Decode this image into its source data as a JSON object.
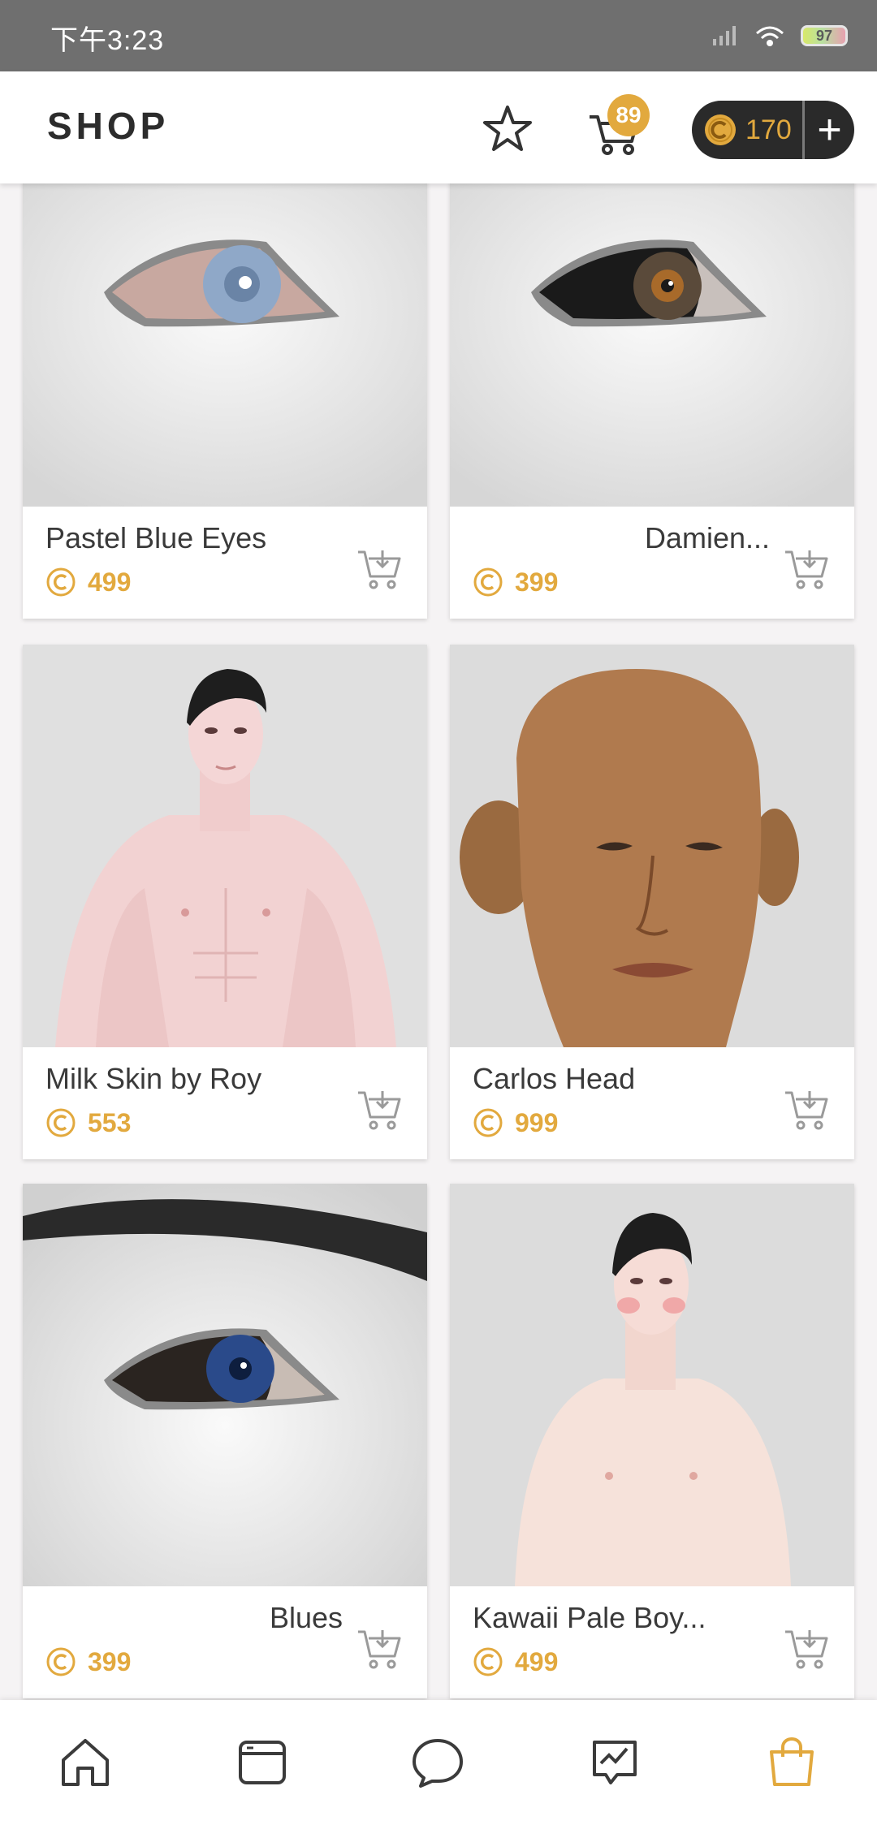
{
  "status_bar": {
    "time": "下午3:23",
    "battery": "97"
  },
  "header": {
    "title": "SHOP",
    "cart_count": "89",
    "coin_balance": "170",
    "add_coins_label": "+"
  },
  "colors": {
    "accent": "#e2a93e",
    "dark": "#2a2a2a",
    "icon": "#3b3b3b",
    "nav_active": "#e2a93e"
  },
  "products": [
    {
      "name": "Pastel Blue Eyes",
      "price": "499",
      "image": "eye-blue",
      "align": "left"
    },
    {
      "name": "Damien...",
      "price": "399",
      "image": "eye-brown",
      "align": "right"
    },
    {
      "name": "Milk Skin by Roy",
      "price": "553",
      "image": "body-pale",
      "align": "left"
    },
    {
      "name": "Carlos Head",
      "price": "999",
      "image": "head-tan",
      "align": "left"
    },
    {
      "name": "Blues",
      "price": "399",
      "image": "eye-dark-blue",
      "align": "right"
    },
    {
      "name": "Kawaii Pale Boy...",
      "price": "499",
      "image": "body-kawaii",
      "align": "left"
    }
  ],
  "bottom_nav": [
    {
      "icon": "home-icon",
      "active": false
    },
    {
      "icon": "browser-icon",
      "active": false
    },
    {
      "icon": "chat-icon",
      "active": false
    },
    {
      "icon": "activity-icon",
      "active": false
    },
    {
      "icon": "shopping-bag-icon",
      "active": true
    }
  ]
}
